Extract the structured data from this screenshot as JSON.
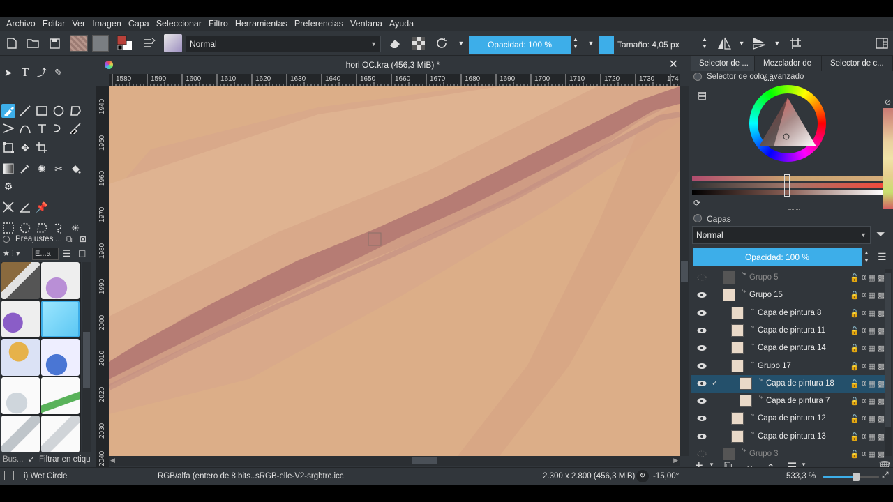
{
  "menu": [
    "Archivo",
    "Editar",
    "Ver",
    "Imagen",
    "Capa",
    "Seleccionar",
    "Filtro",
    "Herramientas",
    "Preferencias",
    "Ventana",
    "Ayude"
  ],
  "toolbar": {
    "blend_mode": "Normal",
    "opacity": "Opacidad: 100 %",
    "size": "Tamaño: 4,05 px"
  },
  "document": {
    "title": "hori OC.kra (456,3 MiB) *"
  },
  "ruler": {
    "h_ticks": [
      "1580",
      "1590",
      "1600",
      "1610",
      "1620",
      "1630",
      "1640",
      "1650",
      "1660",
      "1670",
      "1680",
      "1690",
      "1700",
      "1710",
      "1720",
      "1730",
      "174"
    ],
    "v_ticks": [
      "1940",
      "1950",
      "1960",
      "1970",
      "1980",
      "1990",
      "2000",
      "2010",
      "2020",
      "2030",
      "2040"
    ]
  },
  "presets": {
    "title": "Preajustes ...",
    "tag": "E...a",
    "search_placeholder": "Bus...",
    "filter_label": "Filtrar en etiqu"
  },
  "right_tabs": [
    "Selector de ...",
    "Mezclador de c...",
    "Selector de c..."
  ],
  "color_selector": {
    "title": "Selector de color avanzado"
  },
  "layers": {
    "title": "Capas",
    "blend_mode": "Normal",
    "opacity": "Opacidad:  100 %",
    "rows": [
      {
        "name": "Grupo 5",
        "dim": true,
        "visible": false,
        "indent": 0
      },
      {
        "name": "Grupo 15",
        "dim": false,
        "visible": true,
        "indent": 0
      },
      {
        "name": "Capa de pintura 8",
        "dim": false,
        "visible": true,
        "indent": 1
      },
      {
        "name": "Capa de pintura 11",
        "dim": false,
        "visible": true,
        "indent": 1
      },
      {
        "name": "Capa de pintura 14",
        "dim": false,
        "visible": true,
        "indent": 1
      },
      {
        "name": "Grupo 17",
        "dim": false,
        "visible": true,
        "indent": 1
      },
      {
        "name": "Capa de pintura 18",
        "dim": false,
        "visible": true,
        "indent": 2,
        "selected": true
      },
      {
        "name": "Capa de pintura 7",
        "dim": false,
        "visible": true,
        "indent": 2
      },
      {
        "name": "Capa de pintura 12",
        "dim": false,
        "visible": true,
        "indent": 1
      },
      {
        "name": "Capa de pintura 13",
        "dim": false,
        "visible": true,
        "indent": 1
      },
      {
        "name": "Grupo 3",
        "dim": true,
        "visible": false,
        "indent": 0
      }
    ]
  },
  "status": {
    "brush": "i) Wet Circle",
    "color_space": "RGB/alfa (entero de 8 bits...",
    "profile": "sRGB-elle-V2-srgbtrc.icc",
    "dimensions": "2.300 x 2.800 (456,3 MiB)",
    "rotation": "-15,00°",
    "zoom": "533,3 %"
  },
  "colors": {
    "accent": "#3daee9",
    "skin_base": "#dcae88",
    "stroke": "#b67c74"
  }
}
